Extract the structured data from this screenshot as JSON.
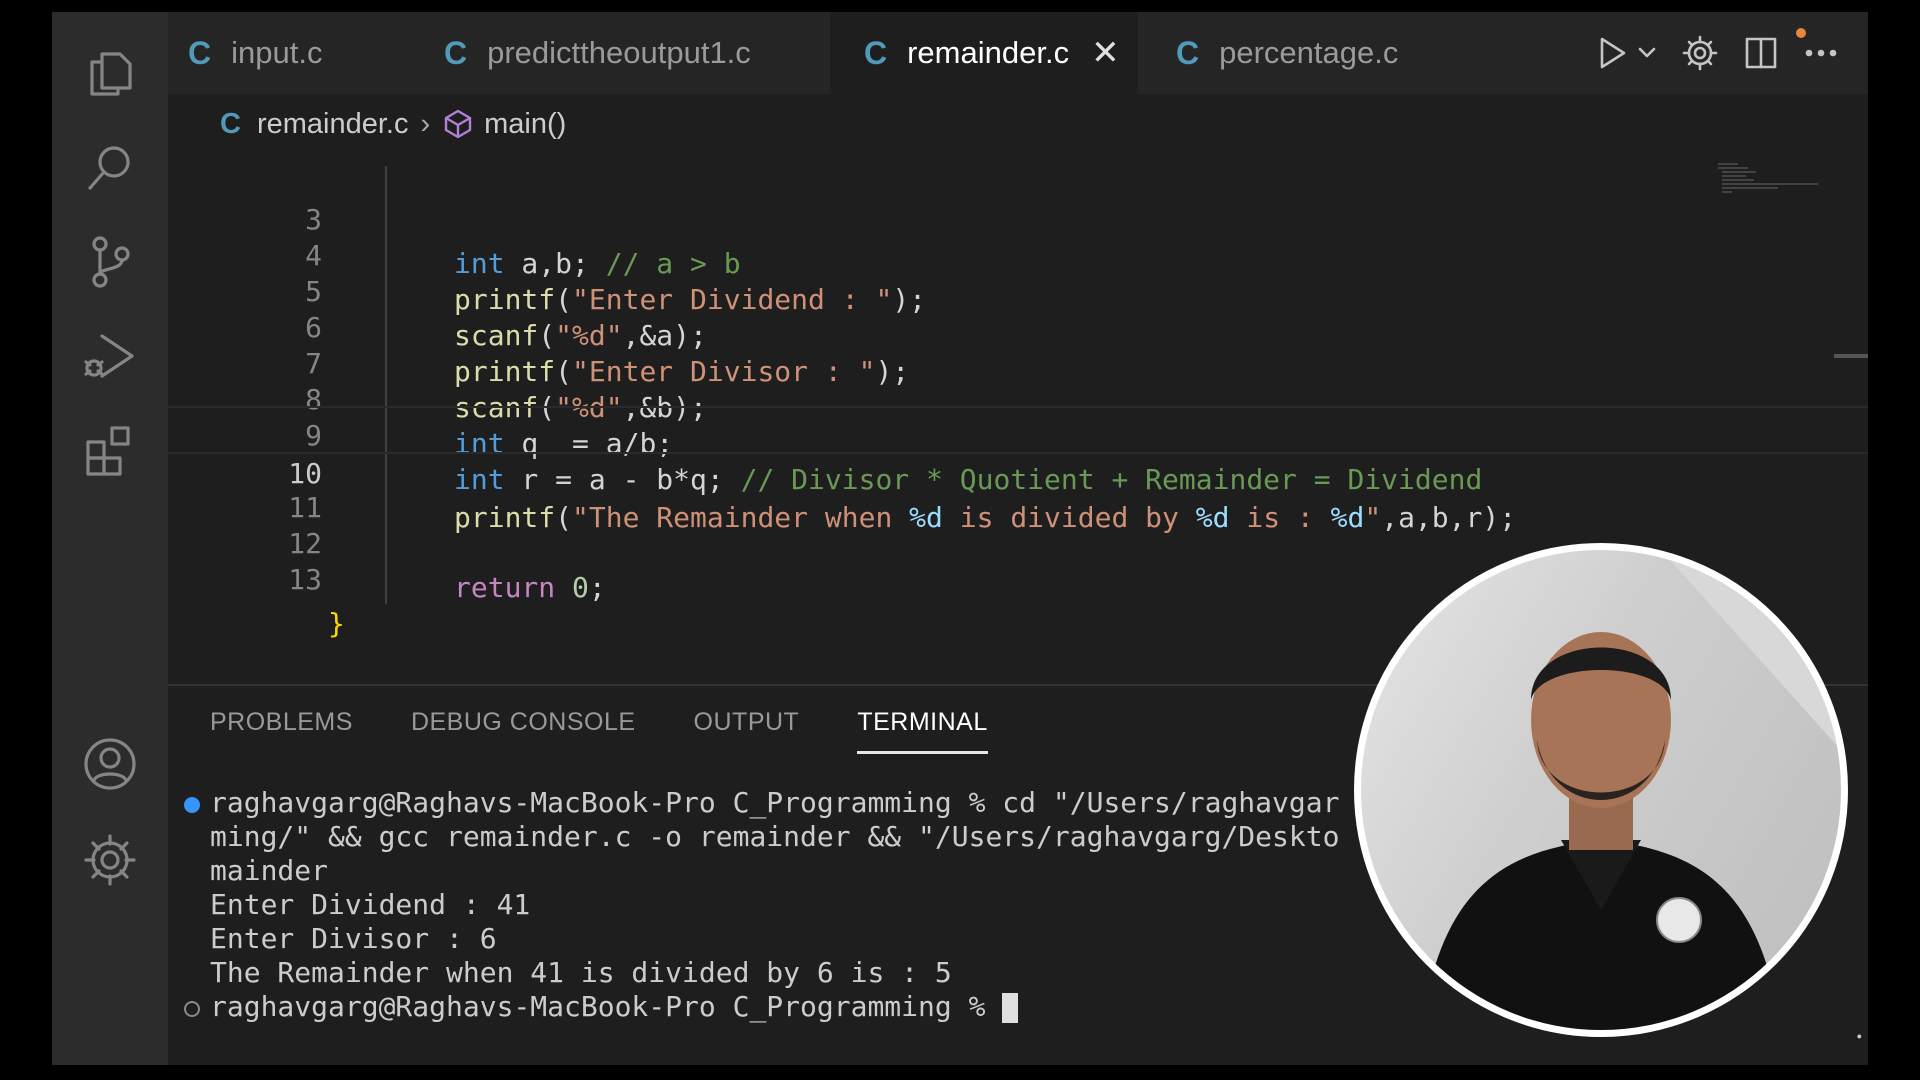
{
  "tabs": [
    {
      "icon": "C",
      "label": "input.c",
      "active": false
    },
    {
      "icon": "C",
      "label": "predicttheoutput1.c",
      "active": false
    },
    {
      "icon": "C",
      "label": "remainder.c",
      "active": true,
      "close": "✕"
    },
    {
      "icon": "C",
      "label": "percentage.c",
      "active": false
    }
  ],
  "breadcrumb": {
    "file_icon": "C",
    "file": "remainder.c",
    "separator": "›",
    "symbol": "main()"
  },
  "editor": {
    "current_line": 10,
    "lines": [
      {
        "num": "3"
      },
      {
        "num": "4"
      },
      {
        "num": "5"
      },
      {
        "num": "6"
      },
      {
        "num": "7"
      },
      {
        "num": "8"
      },
      {
        "num": "9"
      },
      {
        "num": "10"
      },
      {
        "num": "11"
      },
      {
        "num": "12"
      },
      {
        "num": "13"
      }
    ],
    "code": {
      "l3": {
        "kw": "int",
        "rest": " a,b; ",
        "comment": "// a > b"
      },
      "l4": {
        "fn": "printf",
        "open": "(",
        "str": "\"Enter Dividend : \"",
        "close": ");"
      },
      "l5": {
        "fn": "scanf",
        "open": "(",
        "str": "\"%d\"",
        "rest": ",&a);"
      },
      "l6": {
        "fn": "printf",
        "open": "(",
        "str": "\"Enter Divisor : \"",
        "close": ");"
      },
      "l7": {
        "fn": "scanf",
        "open": "(",
        "str": "\"%d\"",
        "rest": ",&b);"
      },
      "l8": {
        "kw": "int",
        "rest": " q  = a/b;"
      },
      "l9": {
        "kw": "int",
        "rest": " r = a - b*q; ",
        "comment": "// Divisor * Quotient + Remainder = Dividend"
      },
      "l10": {
        "fn": "printf",
        "open": "(",
        "s1": "\"The Remainder when ",
        "f1": "%d",
        "s2": " is divided by ",
        "f2": "%d",
        "s3": " is : ",
        "f3": "%d",
        "s4": "\"",
        "rest": ",a,b,r);"
      },
      "l12": {
        "kw": "return",
        "num": " 0",
        "rest": ";"
      },
      "l13": {
        "brace": "}"
      }
    }
  },
  "panel": {
    "tabs": [
      "PROBLEMS",
      "DEBUG CONSOLE",
      "OUTPUT",
      "TERMINAL"
    ],
    "active_tab": "TERMINAL",
    "terminal_lines": [
      "raghavgarg@Raghavs-MacBook-Pro C_Programming % cd \"/Users/raghavgar",
      "ming/\" && gcc remainder.c -o remainder && \"/Users/raghavgarg/Deskto",
      "mainder",
      "Enter Dividend : 41",
      "Enter Divisor : 6",
      "The Remainder when 41 is divided by 6 is : 5",
      "raghavgarg@Raghavs-MacBook-Pro C_Programming % "
    ]
  },
  "colors": {
    "accent": "#519aba",
    "keyword": "#569cd6",
    "string": "#ce9178",
    "function": "#dcdcaa",
    "comment": "#6a9955"
  },
  "icons": [
    "explorer-icon",
    "search-icon",
    "source-control-icon",
    "run-debug-icon",
    "extensions-icon",
    "account-icon",
    "settings-gear-icon",
    "run-icon",
    "chevron-down-icon",
    "gear-icon",
    "split-editor-icon",
    "more-icon",
    "cube-icon"
  ]
}
